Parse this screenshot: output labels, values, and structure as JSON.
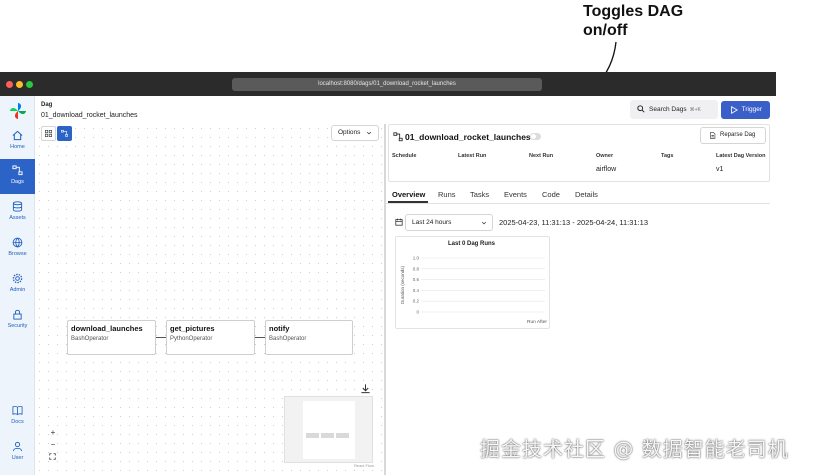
{
  "annotation": {
    "line1": "Toggles DAG",
    "line2": "on/off"
  },
  "browser": {
    "url": "localhost:8080/dags/01_download_rocket_launches",
    "dots": [
      "#ff5f57",
      "#febc2e",
      "#28c840"
    ]
  },
  "sidebar": {
    "items": [
      {
        "label": "Home",
        "icon": "home-icon"
      },
      {
        "label": "Dags",
        "icon": "dags-icon",
        "active": true
      },
      {
        "label": "Assets",
        "icon": "database-icon"
      },
      {
        "label": "Browse",
        "icon": "globe-icon"
      },
      {
        "label": "Admin",
        "icon": "gear-icon"
      },
      {
        "label": "Security",
        "icon": "lock-icon"
      },
      {
        "label": "Docs",
        "icon": "book-icon"
      },
      {
        "label": "User",
        "icon": "user-icon"
      }
    ]
  },
  "header": {
    "breadcrumb_title": "Dag",
    "breadcrumb_dag": "01_download_rocket_launches",
    "search_label": "Search Dags",
    "search_shortcut": "⌘+K",
    "trigger_label": "Trigger"
  },
  "graph": {
    "options_label": "Options",
    "tasks": [
      {
        "name": "download_launches",
        "operator": "BashOperator"
      },
      {
        "name": "get_pictures",
        "operator": "PythonOperator"
      },
      {
        "name": "notify",
        "operator": "BashOperator"
      }
    ],
    "attribution": "React Flow"
  },
  "dag": {
    "title": "01_download_rocket_launches",
    "reparse_label": "Reparse Dag",
    "toggle_on": false,
    "meta": {
      "schedule_label": "Schedule",
      "latest_run_label": "Latest Run",
      "next_run_label": "Next Run",
      "owner_label": "Owner",
      "owner_value": "airflow",
      "tags_label": "Tags",
      "latest_version_label": "Latest Dag Version",
      "latest_version_value": "v1"
    }
  },
  "tabs": [
    "Overview",
    "Runs",
    "Tasks",
    "Events",
    "Code",
    "Details"
  ],
  "overview": {
    "range_label": "Last 24 hours",
    "range_text": "2025-04-23, 11:31:13 - 2025-04-24, 11:31:13"
  },
  "chart_data": {
    "type": "bar",
    "title": "Last 0 Dag Runs",
    "ylabel": "Duration (seconds)",
    "xlabel": "Run After",
    "yticks": [
      "1.0",
      "0.8",
      "0.6",
      "0.4",
      "0.2",
      "0"
    ],
    "ylim": [
      0,
      1
    ],
    "categories": [],
    "values": [],
    "grid": true
  },
  "watermark": "掘金技术社区 @ 数据智能老司机"
}
